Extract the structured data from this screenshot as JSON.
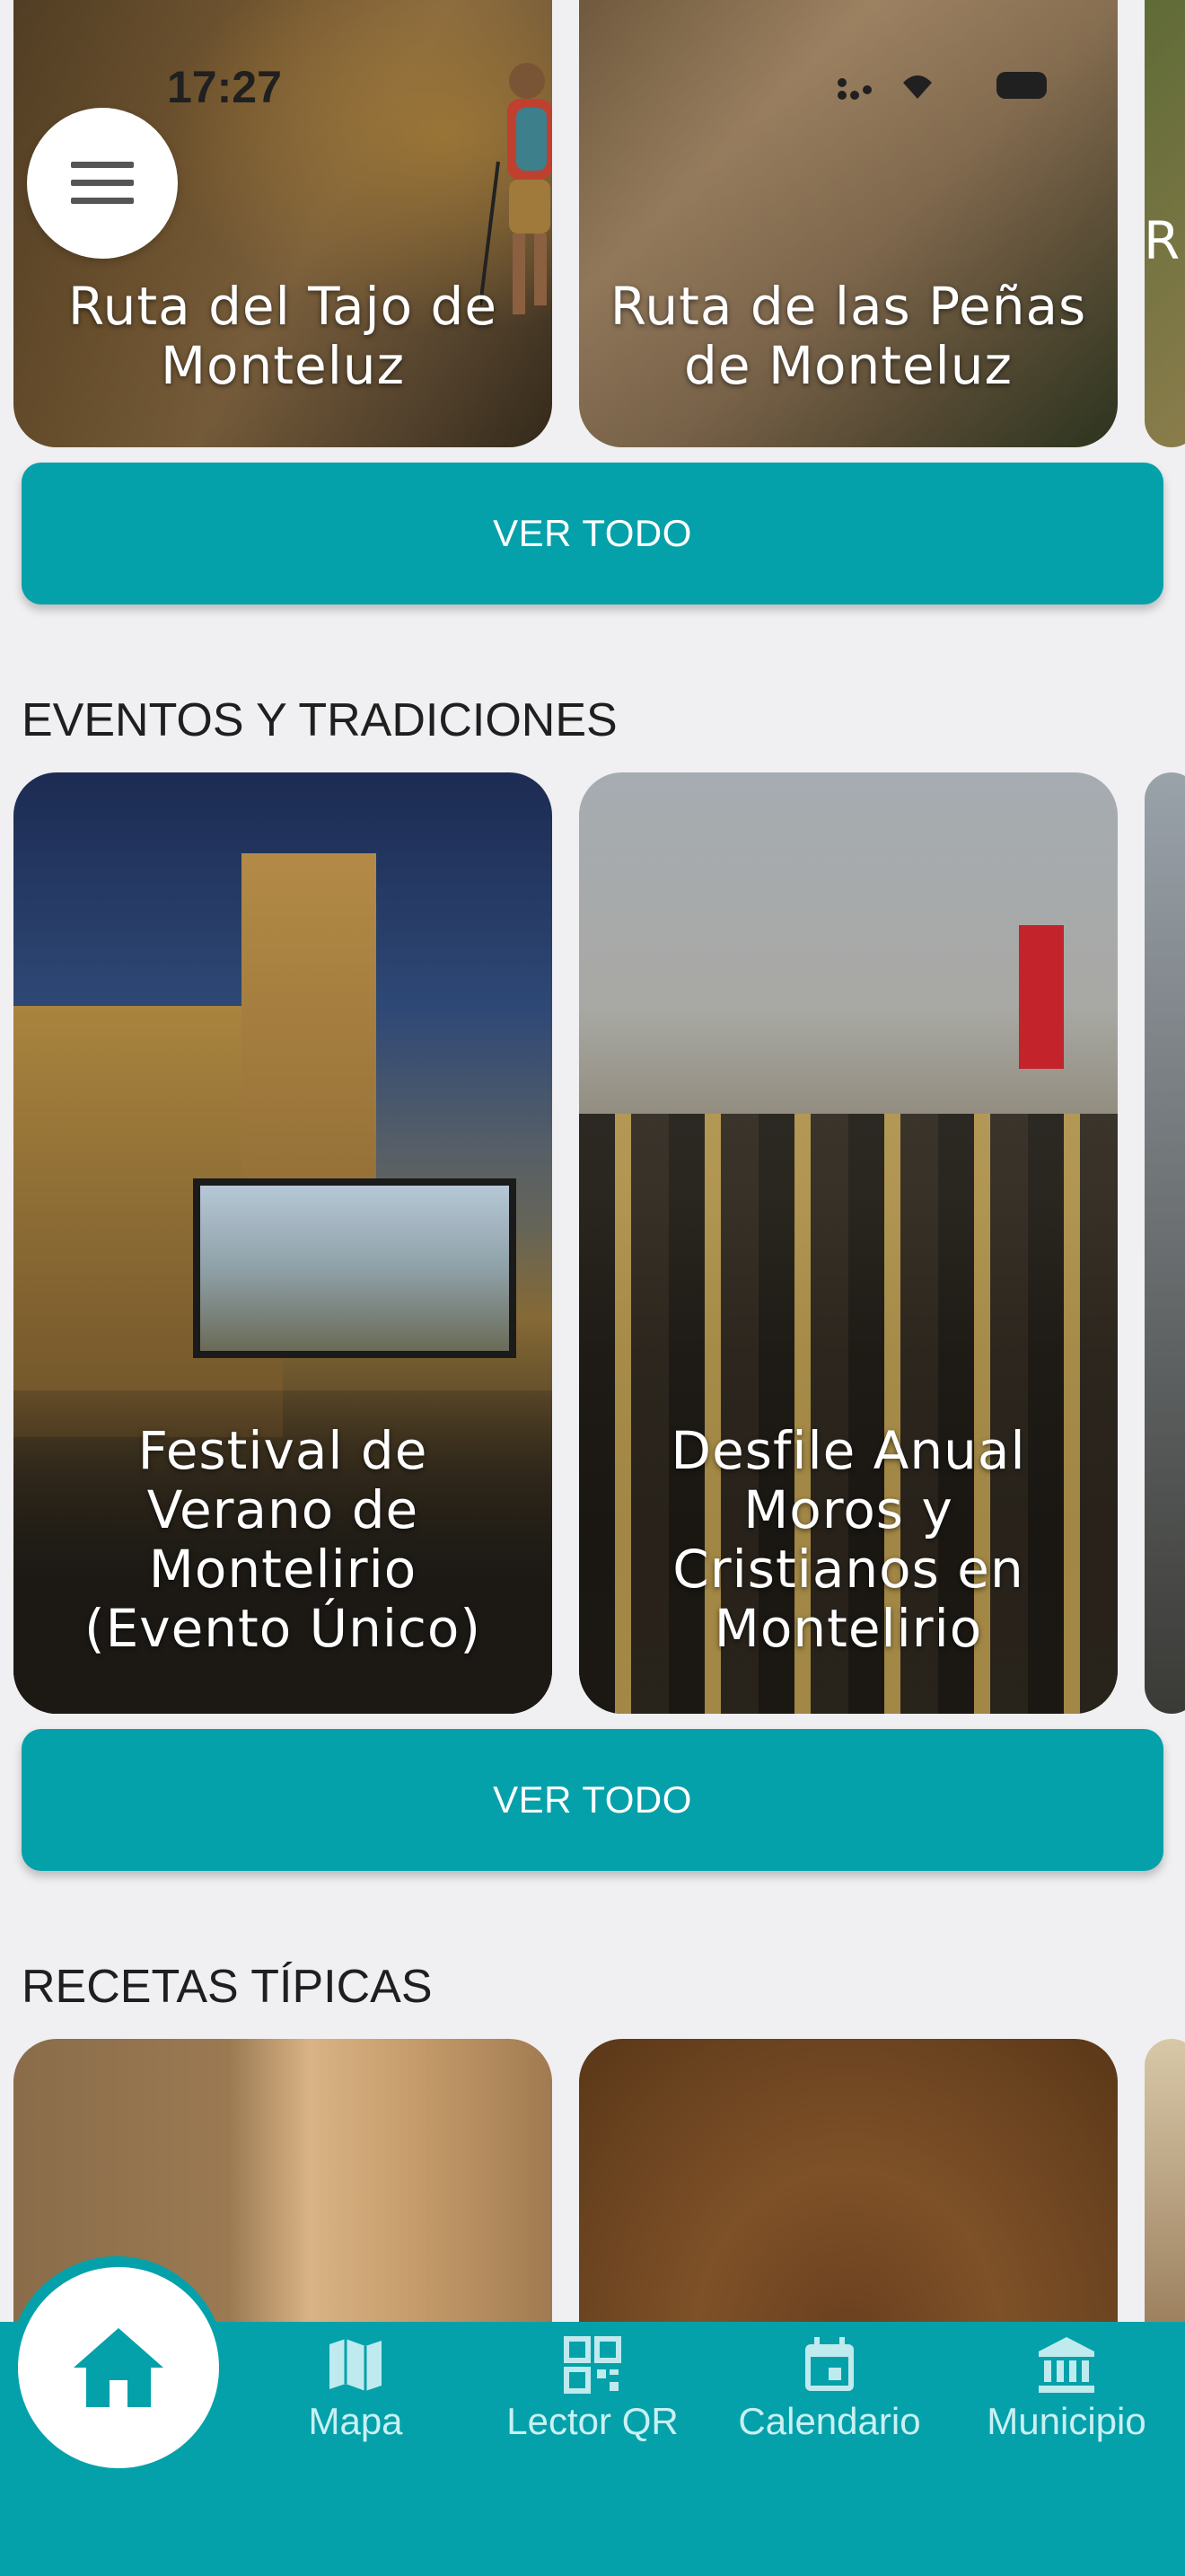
{
  "status_bar": {
    "time": "17:27"
  },
  "routes": {
    "cards": [
      {
        "title": "Ruta del Tajo de Monteluz"
      },
      {
        "title": "Ruta de las Peñas de Monteluz"
      },
      {
        "title": "R"
      }
    ],
    "view_all_label": "VER TODO"
  },
  "events": {
    "heading": "EVENTOS Y TRADICIONES",
    "cards": [
      {
        "title": "Festival de Verano de Montelirio (Evento Único)"
      },
      {
        "title": "Desfile Anual Moros y Cristianos en Montelirio"
      }
    ],
    "view_all_label": "VER TODO"
  },
  "recipes": {
    "heading": "RECETAS TÍPICAS"
  },
  "bottom_nav": {
    "items": [
      {
        "label": "Mapa",
        "icon": "map-icon"
      },
      {
        "label": "Lector QR",
        "icon": "qr-code-icon"
      },
      {
        "label": "Calendario",
        "icon": "calendar-icon"
      },
      {
        "label": "Municipio",
        "icon": "bank-icon"
      }
    ],
    "home_icon": "home-icon"
  },
  "colors": {
    "accent": "#04a1aa",
    "background": "#f0eff1",
    "nav_label": "#c9f0f3"
  }
}
